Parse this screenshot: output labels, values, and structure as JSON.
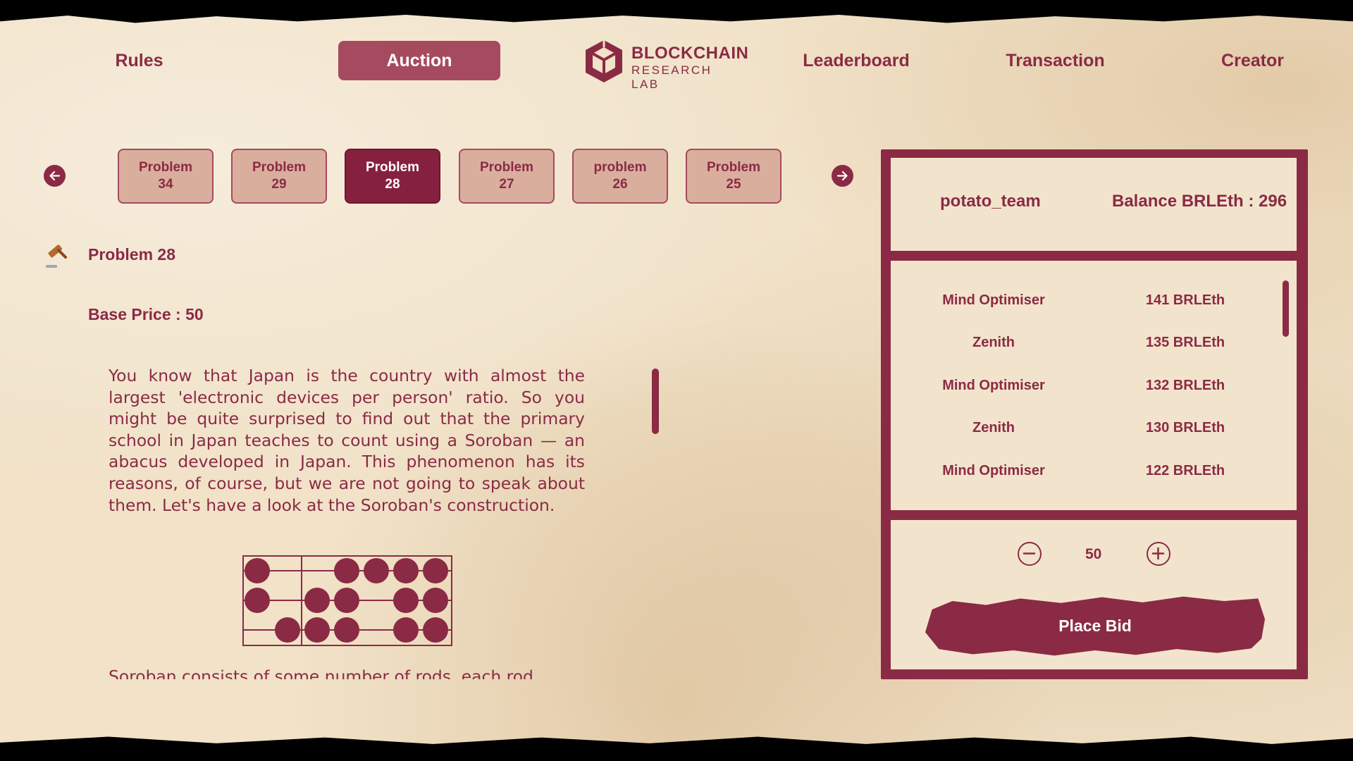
{
  "nav": {
    "rules": "Rules",
    "auction": "Auction",
    "leaderboard": "Leaderboard",
    "transaction": "Transaction",
    "creator": "Creator"
  },
  "logo": {
    "line1": "BLOCKCHAIN",
    "line2": "RESEARCH LAB"
  },
  "icons": {
    "prev": "arrow-left-icon",
    "next": "arrow-right-icon",
    "gavel": "gavel-icon",
    "minus": "minus-circle-icon",
    "plus": "plus-circle-icon"
  },
  "problem_tabs": [
    {
      "line1": "Problem",
      "line2": "34"
    },
    {
      "line1": "Problem",
      "line2": "29"
    },
    {
      "line1": "Problem",
      "line2": "28"
    },
    {
      "line1": "Problem",
      "line2": "27"
    },
    {
      "line1": "problem",
      "line2": "26"
    },
    {
      "line1": "Problem",
      "line2": "25"
    }
  ],
  "active_tab_index": 2,
  "problem": {
    "title": "Problem 28",
    "base_price": "Base Price : 50",
    "description": "You know that Japan is the country with almost the largest 'electronic devices per person' ratio. So you might be quite surprised to find out that the primary school in Japan teaches to count using a Soroban — an abacus developed in Japan. This phenomenon has its reasons, of course, but we are not going to speak about them. Let's have a look at the Soroban's construction.",
    "description_cont": "Soroban consists of some number of rods, each rod"
  },
  "account": {
    "team": "potato_team",
    "balance": "Balance BRLEth : 296"
  },
  "bids": [
    {
      "name": "Mind Optimiser",
      "amount": "141 BRLEth"
    },
    {
      "name": "Zenith",
      "amount": "135 BRLEth"
    },
    {
      "name": "Mind Optimiser",
      "amount": "132 BRLEth"
    },
    {
      "name": "Zenith",
      "amount": "130 BRLEth"
    },
    {
      "name": "Mind Optimiser",
      "amount": "122 BRLEth"
    }
  ],
  "bid_amount": "50",
  "place_bid_label": "Place Bid",
  "colors": {
    "accent": "#8b2a45",
    "paper": "#f1e2c8",
    "tab_inactive": "#d9ae9d"
  }
}
